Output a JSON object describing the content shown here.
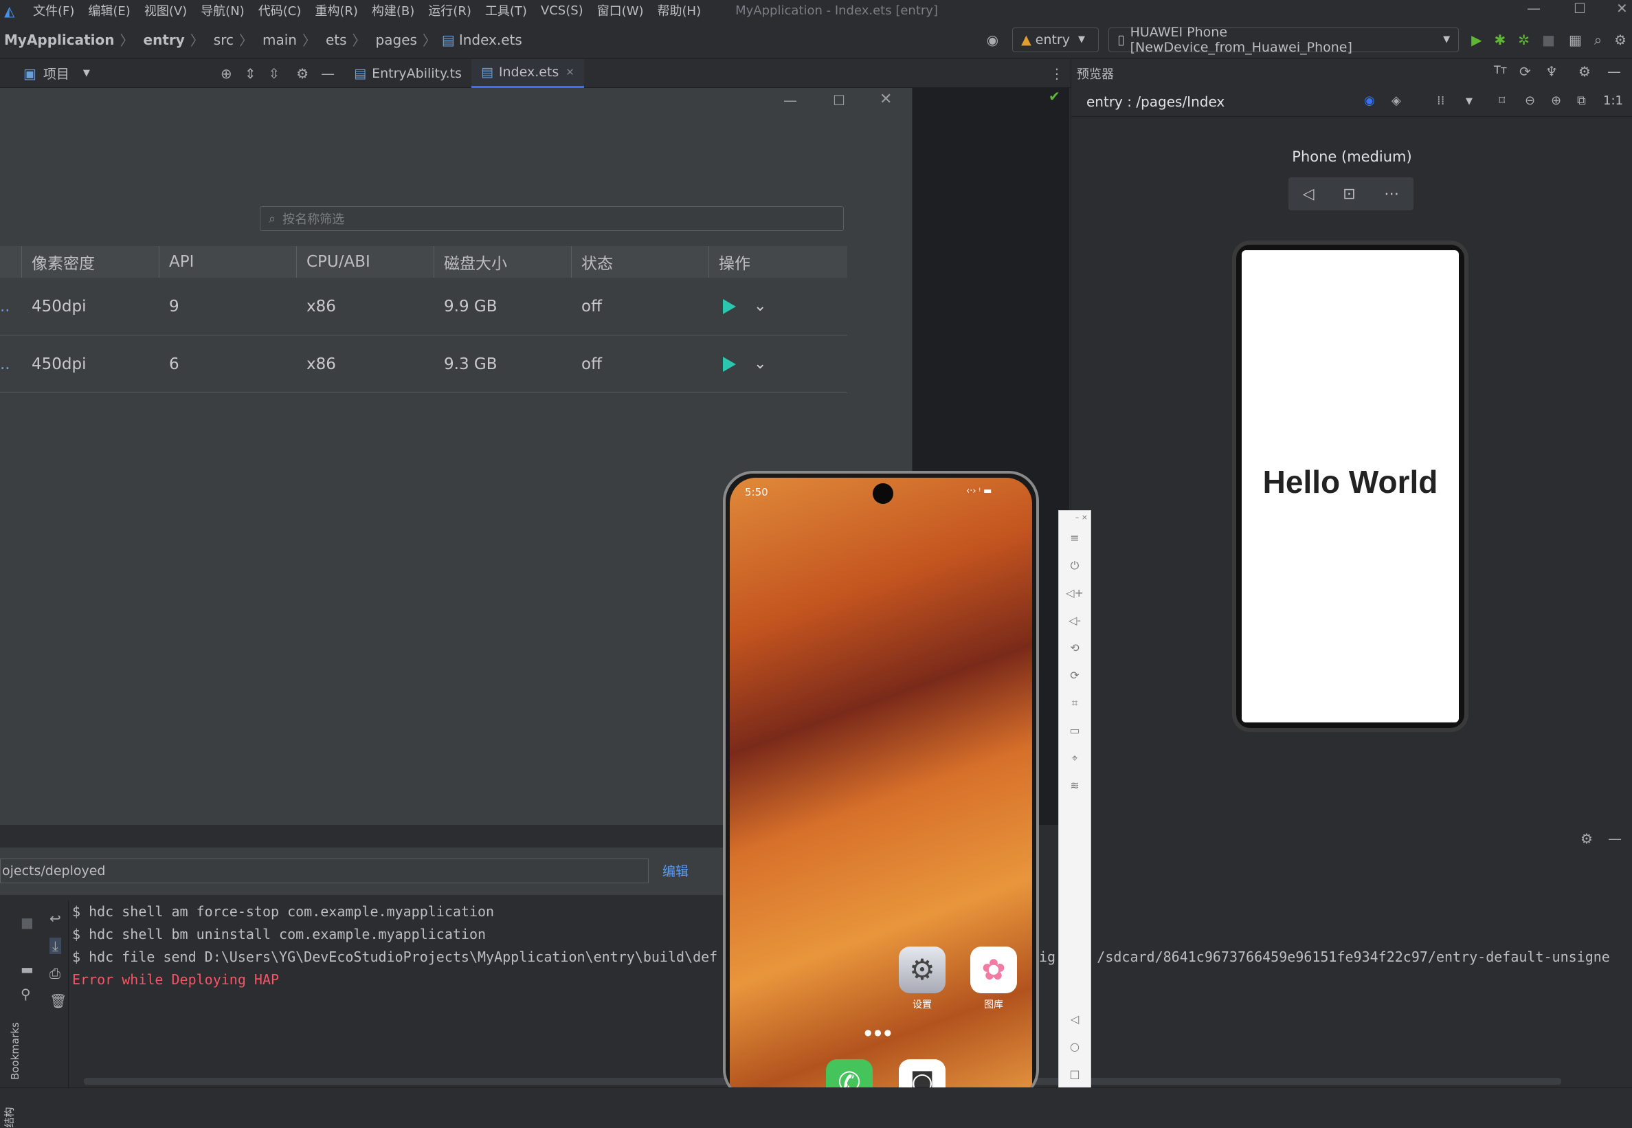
{
  "menubar": {
    "items": [
      "文件(F)",
      "编辑(E)",
      "视图(V)",
      "导航(N)",
      "代码(C)",
      "重构(R)",
      "构建(B)",
      "运行(R)",
      "工具(T)",
      "VCS(S)",
      "窗口(W)",
      "帮助(H)"
    ],
    "window_title": "MyApplication - Index.ets [entry]"
  },
  "breadcrumb": [
    "MyApplication",
    "entry",
    "src",
    "main",
    "ets",
    "pages",
    "Index.ets"
  ],
  "toolbar": {
    "module": "entry",
    "device": "HUAWEI Phone [NewDevice_from_Huawei_Phone]"
  },
  "tool_window": {
    "project_label": "项目"
  },
  "tabs": [
    "EntryAbility.ts",
    "Index.ets"
  ],
  "device_manager": {
    "search_placeholder": "按名称筛选",
    "columns": [
      "像素密度",
      "API",
      "CPU/ABI",
      "磁盘大小",
      "状态",
      "操作"
    ],
    "rows": [
      {
        "density": "450dpi",
        "api": "9",
        "abi": "x86",
        "disk": "9.9 GB",
        "status": "off"
      },
      {
        "density": "450dpi",
        "api": "6",
        "abi": "x86",
        "disk": "9.3 GB",
        "status": "off"
      }
    ],
    "path_value": "ojects/deployed",
    "edit_label": "编辑"
  },
  "previewer": {
    "title": "预览器",
    "route": "entry : /pages/Index",
    "device_name": "Phone (medium)",
    "content_text": "Hello World"
  },
  "console": {
    "lines": [
      "$ hdc shell am force-stop com.example.myapplication",
      "$ hdc shell bm uninstall com.example.myapplication",
      "$ hdc file send D:\\Users\\YG\\DevEcoStudioProjects\\MyApplication\\entry\\build\\def"
    ],
    "line3_tail": "ig    hap /sdcard/8641c9673766459e96151fe934f22c97/entry-default-unsigne",
    "error": "Error while Deploying HAP",
    "error_color": "#f75464"
  },
  "left_strip": {
    "bookmarks": "Bookmarks",
    "structure": "结构"
  },
  "emulator": {
    "time": "5:50",
    "apps": [
      {
        "label": "设置"
      },
      {
        "label": "图库"
      }
    ]
  },
  "colors": {
    "accent": "#3574f0",
    "play": "#2bc6b0",
    "run": "#5fb832"
  }
}
